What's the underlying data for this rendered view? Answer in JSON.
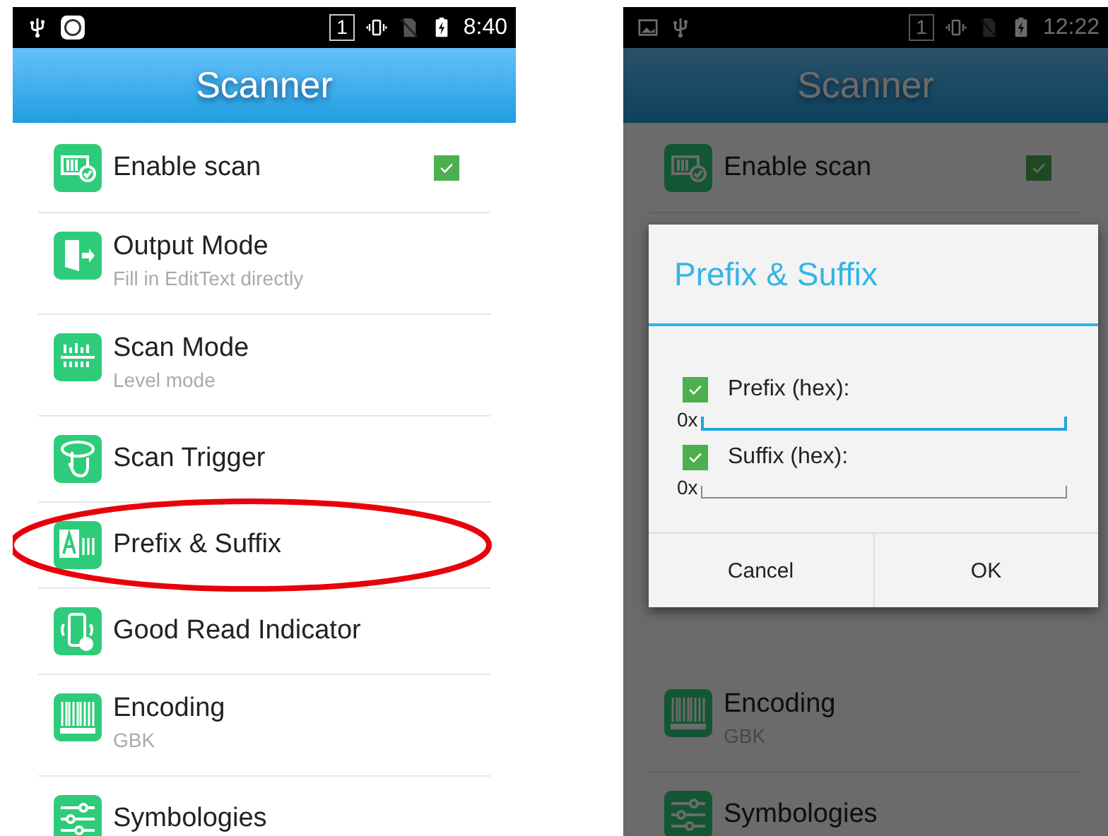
{
  "screens": [
    {
      "status_bar": {
        "sim_slot": "1",
        "time": "8:40"
      },
      "title": "Scanner",
      "items": [
        {
          "title": "Enable scan",
          "kind": "check",
          "checked": true,
          "highlighted": false
        },
        {
          "title": "Output Mode",
          "subtitle": "Fill in EditText directly",
          "kind": "plain",
          "highlighted": false
        },
        {
          "title": "Scan Mode",
          "subtitle": "Level mode",
          "kind": "plain",
          "highlighted": false
        },
        {
          "title": "Scan Trigger",
          "kind": "plain",
          "highlighted": false
        },
        {
          "title": "Prefix & Suffix",
          "kind": "plain",
          "highlighted": true
        },
        {
          "title": "Good Read Indicator",
          "kind": "plain",
          "highlighted": false
        },
        {
          "title": "Encoding",
          "subtitle": "GBK",
          "kind": "plain",
          "highlighted": false
        },
        {
          "title": "Symbologies",
          "kind": "plain",
          "highlighted": false
        }
      ]
    },
    {
      "status_bar": {
        "sim_slot": "1",
        "time": "12:22"
      },
      "title": "Scanner",
      "items": [
        {
          "title": "Enable scan",
          "kind": "check",
          "checked": true,
          "highlighted": false
        }
      ],
      "items_below": [
        {
          "title": "Encoding",
          "subtitle": "GBK",
          "highlighted": false
        },
        {
          "title": "Symbologies",
          "highlighted": false
        }
      ],
      "dialog": {
        "title": "Prefix & Suffix",
        "options": [
          {
            "label": "Prefix (hex):",
            "checked": true,
            "prefix": "0x",
            "focused": true
          },
          {
            "label": "Suffix (hex):",
            "checked": true,
            "prefix": "0x",
            "focused": false
          }
        ],
        "buttons": [
          "Cancel",
          "OK"
        ]
      }
    }
  ]
}
